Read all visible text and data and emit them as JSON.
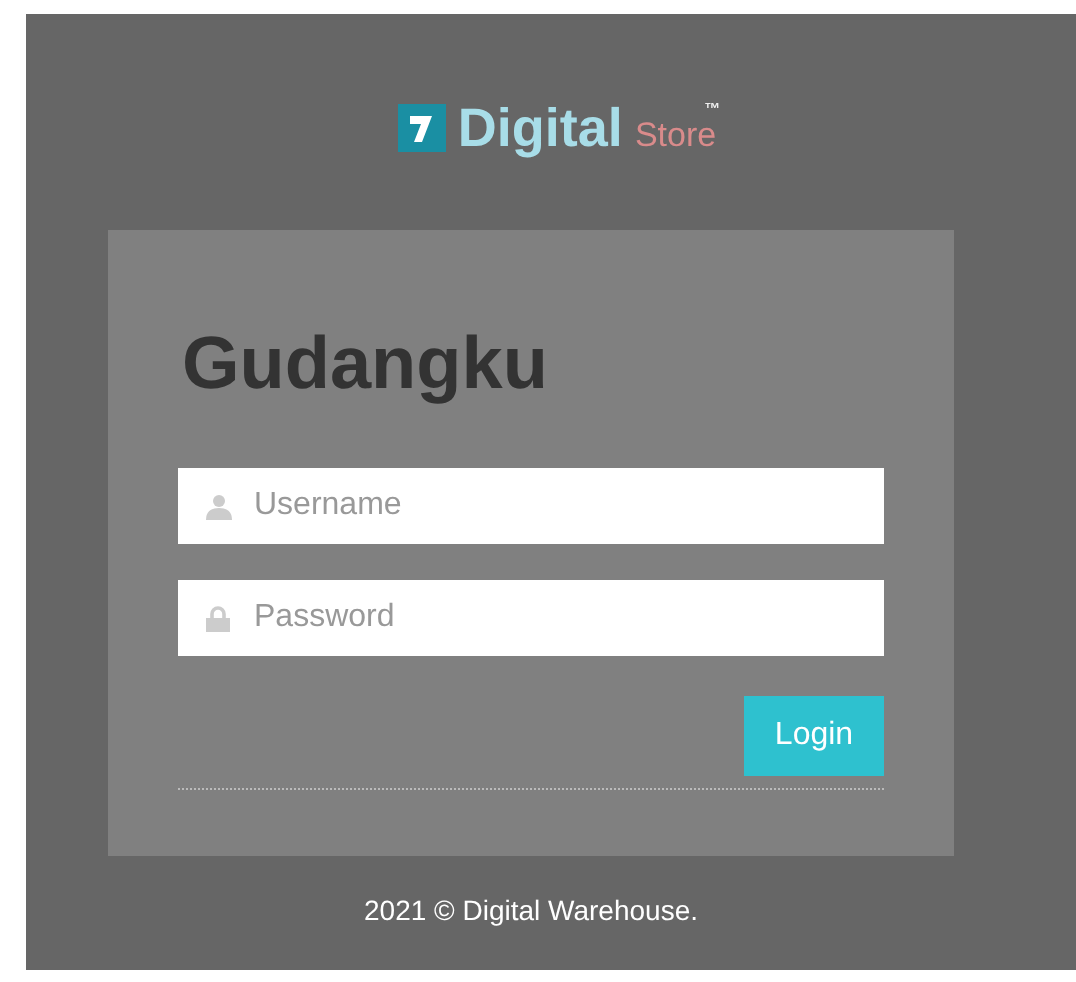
{
  "logo": {
    "brand": "Digital",
    "sub": "Store",
    "mark": "™"
  },
  "login": {
    "title": "Gudangku",
    "fields": [
      {
        "kind": "user",
        "placeholder": "Username"
      },
      {
        "kind": "lock",
        "placeholder": "Password"
      }
    ],
    "button": "Login"
  },
  "footer": "2021 © Digital Warehouse."
}
